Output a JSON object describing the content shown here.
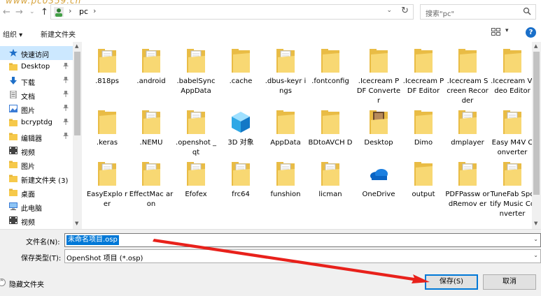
{
  "window": {
    "watermark": "www.pc0359.cn"
  },
  "address_bar": {
    "back_glyph": "←",
    "forward_glyph": "→",
    "recent_glyph": "⌄",
    "up_glyph": "↑",
    "path_separator": "›",
    "path_current": "pc",
    "path_dropdown_glyph": "⌄",
    "refresh_glyph": "↻",
    "search_placeholder": "搜索\"pc\"",
    "icon_names": [
      "back-icon",
      "forward-icon",
      "recent-locations-icon",
      "up-icon",
      "user-folder-icon",
      "refresh-icon",
      "search-icon"
    ]
  },
  "toolbar": {
    "organize_label": "组织 ▾",
    "new_folder_label": "新建文件夹",
    "view_dropdown_glyph": "▾",
    "help_glyph": "?"
  },
  "nav": {
    "items": [
      {
        "label": "快速访问",
        "icon": "star-icon",
        "pinned": false,
        "selected": true
      },
      {
        "label": "Desktop",
        "icon": "folder-icon",
        "pinned": true,
        "selected": false
      },
      {
        "label": "下载",
        "icon": "download-icon",
        "pinned": true,
        "selected": false
      },
      {
        "label": "文档",
        "icon": "document-icon",
        "pinned": true,
        "selected": false
      },
      {
        "label": "图片",
        "icon": "pictures-icon",
        "pinned": true,
        "selected": false
      },
      {
        "label": "bcryptdg",
        "icon": "folder-icon",
        "pinned": true,
        "selected": false
      },
      {
        "label": "编辑器",
        "icon": "folder-icon",
        "pinned": true,
        "selected": false
      },
      {
        "label": "视频",
        "icon": "video-icon",
        "pinned": false,
        "selected": false
      },
      {
        "label": "图片",
        "icon": "folder-icon",
        "pinned": false,
        "selected": false
      },
      {
        "label": "新建文件夹 (3)",
        "icon": "folder-icon",
        "pinned": false,
        "selected": false
      },
      {
        "label": "桌面",
        "icon": "folder-icon",
        "pinned": false,
        "selected": false
      },
      {
        "label": "此电脑",
        "icon": "computer-icon",
        "pinned": false,
        "selected": false
      },
      {
        "label": "视频",
        "icon": "video-icon",
        "pinned": false,
        "selected": false
      }
    ],
    "pin_glyph": "📌",
    "scroll_up_glyph": "▲",
    "scroll_down_glyph": "▼"
  },
  "files": {
    "items": [
      {
        "name": ".818ps",
        "icon": "folder-docs-icon"
      },
      {
        "name": ".android",
        "icon": "folder-docs-icon"
      },
      {
        "name": ".babelSync AppData",
        "icon": "folder-docs-icon"
      },
      {
        "name": ".cache",
        "icon": "folder-icon"
      },
      {
        "name": ".dbus-keyr ings",
        "icon": "folder-docs-icon"
      },
      {
        "name": ".fontconfig",
        "icon": "folder-icon"
      },
      {
        "name": ".Icecream PDF Converter",
        "icon": "folder-icon"
      },
      {
        "name": ".Icecream PDF Editor",
        "icon": "folder-icon"
      },
      {
        "name": ".Icecream Screen Recorder",
        "icon": "folder-icon"
      },
      {
        "name": ".Icecream Video Editor",
        "icon": "folder-icon"
      },
      {
        "name": ".keras",
        "icon": "folder-icon"
      },
      {
        "name": ".NEMU",
        "icon": "folder-docs-icon"
      },
      {
        "name": ".openshot _qt",
        "icon": "folder-docs-icon"
      },
      {
        "name": "3D 对象",
        "icon": "3d-objects-icon"
      },
      {
        "name": "AppData",
        "icon": "folder-icon"
      },
      {
        "name": "BDtoAVCH D",
        "icon": "folder-icon"
      },
      {
        "name": "Desktop",
        "icon": "folder-image-icon"
      },
      {
        "name": "Dimo",
        "icon": "folder-icon"
      },
      {
        "name": "dmplayer",
        "icon": "folder-docs-icon"
      },
      {
        "name": "Easy M4V Converter",
        "icon": "folder-docs-icon"
      },
      {
        "name": "EasyExplo rer",
        "icon": "folder-docs-icon"
      },
      {
        "name": "EffectMac aron",
        "icon": "folder-docs-icon"
      },
      {
        "name": "Efofex",
        "icon": "folder-docs-icon"
      },
      {
        "name": "frc64",
        "icon": "folder-docs-icon"
      },
      {
        "name": "funshion",
        "icon": "folder-docs-icon"
      },
      {
        "name": "licman",
        "icon": "folder-docs-icon"
      },
      {
        "name": "OneDrive",
        "icon": "onedrive-icon"
      },
      {
        "name": "output",
        "icon": "folder-icon"
      },
      {
        "name": "PDFPassw ordRemov er",
        "icon": "folder-docs-icon"
      },
      {
        "name": "TuneFab Spotify Music Converter",
        "icon": "folder-docs-icon"
      }
    ],
    "scroll_up_glyph": "▲",
    "scroll_down_glyph": "▼"
  },
  "form": {
    "filename_label": "文件名(N):",
    "filename_value": "未命名项目.osp",
    "filetype_label": "保存类型(T):",
    "filetype_value": "OpenShot 项目 (*.osp)",
    "dropdown_glyph": "⌄",
    "hide_folders_label": "隐藏文件夹",
    "hide_folders_glyph": "^",
    "save_label": "保存(S)",
    "cancel_label": "取消"
  },
  "colors": {
    "accent": "#0078d7",
    "selection": "#cce8ff",
    "folder": "#f6d66b",
    "annotation_arrow": "#e8211b"
  }
}
